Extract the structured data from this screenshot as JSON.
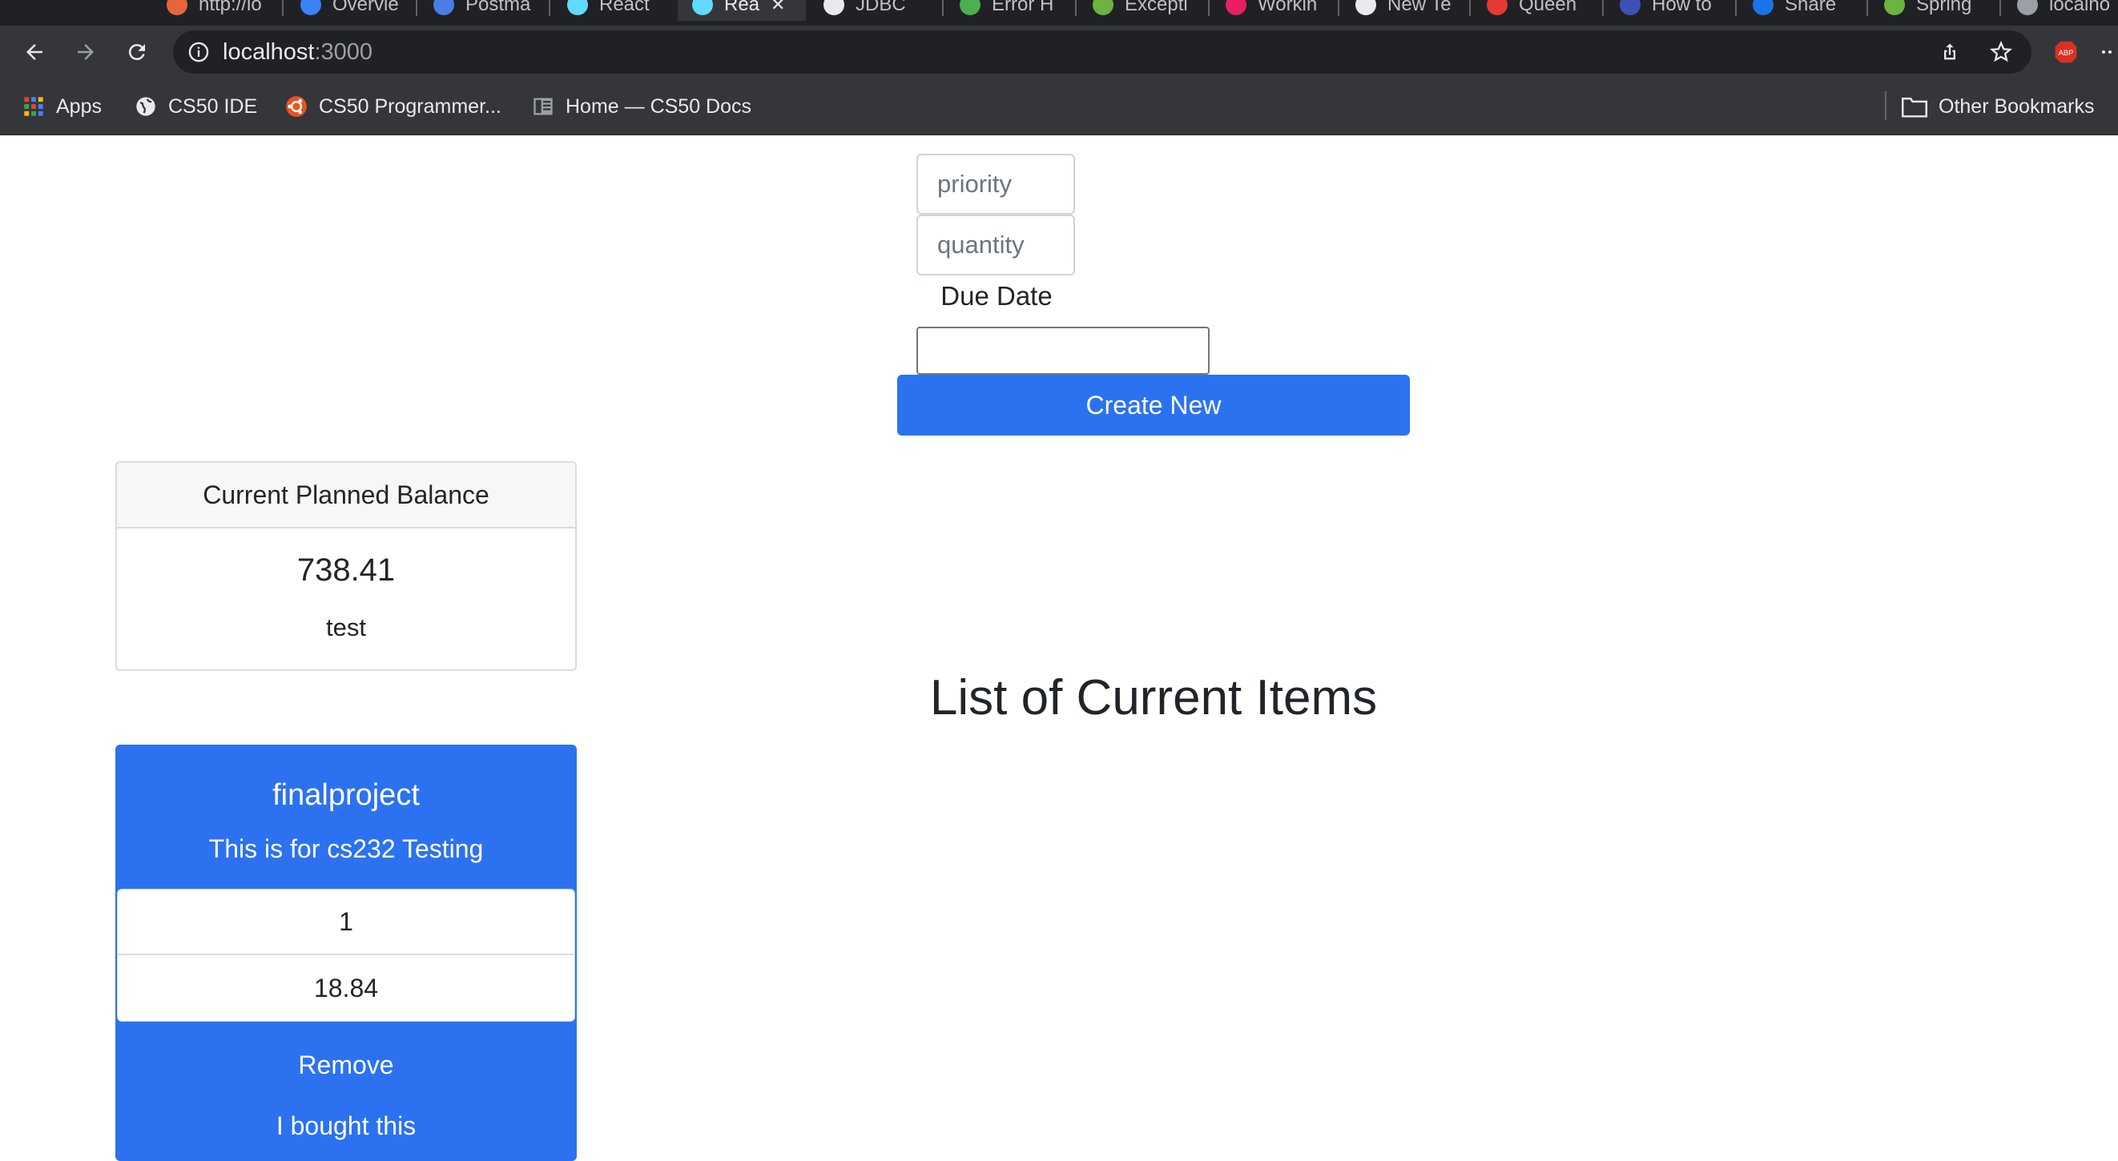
{
  "browser": {
    "tabs": [
      {
        "label": "http://lo",
        "icon": "red-circle-icon",
        "color": "#e8643b"
      },
      {
        "label": "Overvie",
        "icon": "blue-circle-icon",
        "color": "#3b82f6"
      },
      {
        "label": "Postma",
        "icon": "blue-square-icon",
        "color": "#4a7de6"
      },
      {
        "label": "React",
        "icon": "react-icon",
        "color": "#61dafb"
      },
      {
        "label": "Rea",
        "icon": "react-icon",
        "color": "#61dafb",
        "active": true
      },
      {
        "label": "JDBC",
        "icon": "mail-icon",
        "color": "#e8eaed"
      },
      {
        "label": "Error H",
        "icon": "green-square-icon",
        "color": "#4caf50"
      },
      {
        "label": "Excepti",
        "icon": "spring-icon",
        "color": "#6db33f"
      },
      {
        "label": "Workin",
        "icon": "pink-circle-icon",
        "color": "#e91e63"
      },
      {
        "label": "New Te",
        "icon": "github-icon",
        "color": "#e8eaed"
      },
      {
        "label": "Queen",
        "icon": "infinity-icon",
        "color": "#e53935"
      },
      {
        "label": "How to",
        "icon": "blue-circle-icon",
        "color": "#3f51b5"
      },
      {
        "label": "Share",
        "icon": "blue-circle-icon",
        "color": "#1a73e8"
      },
      {
        "label": "Spring",
        "icon": "spring-icon",
        "color": "#6db33f"
      },
      {
        "label": "localho",
        "icon": "globe-icon",
        "color": "#9aa0a6"
      }
    ],
    "url_host": "localhost",
    "url_port": ":3000",
    "bookmarks": {
      "apps": "Apps",
      "cs50_ide": "CS50 IDE",
      "cs50_programmer": "CS50 Programmer...",
      "cs50_docs": "Home — CS50 Docs",
      "other": "Other Bookmarks"
    }
  },
  "form": {
    "priority_placeholder": "priority",
    "quantity_placeholder": "quantity",
    "due_date_label": "Due Date",
    "due_date_value": "",
    "create_button": "Create New"
  },
  "balance": {
    "header": "Current Planned Balance",
    "amount": "738.41",
    "note": "test"
  },
  "list_title": "List of Current Items",
  "items": [
    {
      "name": "finalproject",
      "description": "This is for cs232 Testing",
      "priority": "1",
      "price": "18.84",
      "remove_label": "Remove",
      "bought_label": "I bought this"
    }
  ],
  "colors": {
    "primary": "#2c72f0",
    "chrome_dark": "#202124",
    "chrome_toolbar": "#35363a"
  }
}
